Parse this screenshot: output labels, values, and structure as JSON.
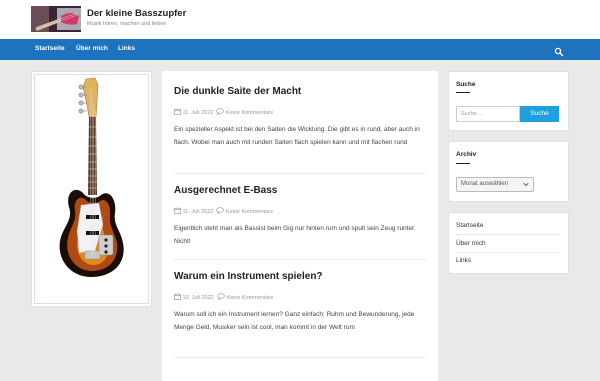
{
  "site": {
    "title": "Der kleine Basszupfer",
    "description": "Musik hören, machen und lieben"
  },
  "nav": {
    "items": [
      "Startseite",
      "Über mich",
      "Links"
    ]
  },
  "posts": [
    {
      "title": "Die dunkle Saite der Macht",
      "date": "11. Juli 2022",
      "comments": "Keine Kommentare",
      "excerpt": "Ein spezieller Aspekt ist bei den Saiten die Wicklung. Die gibt es in rund, aber auch in flach. Wobei man auch mit runden Saiten flach spielen kann und mit flachen rund"
    },
    {
      "title": "Ausgerechnet E-Bass",
      "date": "11. Juli 2022",
      "comments": "Keine Kommentare",
      "excerpt": "Eigentlich steht man als Bassist beim Gig nur hinten rum und spult sein Zeug runter. Nicht!"
    },
    {
      "title": "Warum ein Instrument spielen?",
      "date": "10. Juli 2022",
      "comments": "Keine Kommentare",
      "excerpt": "Warum soll ich ein Instrument lernen? Ganz einfach: Ruhm und Bewunderung, jede Menge Geld, Musiker sein ist cool, man kommt in der Welt rum"
    }
  ],
  "sidebar": {
    "search": {
      "title": "Suche",
      "placeholder": "Suche …",
      "button": "Suche"
    },
    "archive": {
      "title": "Archiv",
      "select": "Monat auswählen"
    },
    "links": [
      "Startseite",
      "Über mich",
      "Links"
    ]
  },
  "colors": {
    "nav_bg": "#1e73be",
    "search_button": "#1ea0dc",
    "page_bg": "#e9e9e9"
  },
  "icons": {
    "nav_search": "search-icon",
    "post_date": "calendar-icon",
    "post_comments": "comment-icon"
  }
}
